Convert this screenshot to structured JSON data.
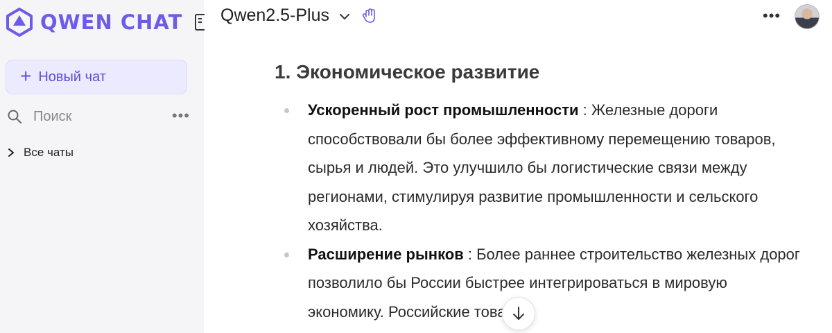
{
  "sidebar": {
    "brand_name": "QWEN CHAT",
    "new_chat_label": "Новый чат",
    "search_placeholder": "Поиск",
    "more_label": "•••",
    "all_chats_label": "Все чаты"
  },
  "topbar": {
    "model_name": "Qwen2.5-Plus",
    "more_label": "•••"
  },
  "content": {
    "section_heading": "1. Экономическое развитие",
    "bullets": [
      {
        "title": "Ускоренный рост промышленности",
        "separator": " : ",
        "text": "Железные дороги способствовали бы более эффективному перемещению товаров, сырья и людей. Это улучшило бы логистические связи между регионами, стимулируя развитие промышленности и сельского хозяйства."
      },
      {
        "title": "Расширение рынков",
        "separator": " : ",
        "text": "Более раннее строительство железных дорог позволило бы России быстрее интегрироваться в мировую экономику. Российские товары"
      }
    ]
  },
  "colors": {
    "accent": "#6c5ce7",
    "sidebar_bg": "#f5f5f7",
    "new_chat_bg": "#eceaff"
  },
  "icons": [
    "qwen-logo-icon",
    "sidebar-toggle-icon",
    "plus-icon",
    "search-icon",
    "more-icon",
    "chevron-right-icon",
    "chevron-down-icon",
    "hand-icon",
    "avatar",
    "arrow-down-icon"
  ]
}
